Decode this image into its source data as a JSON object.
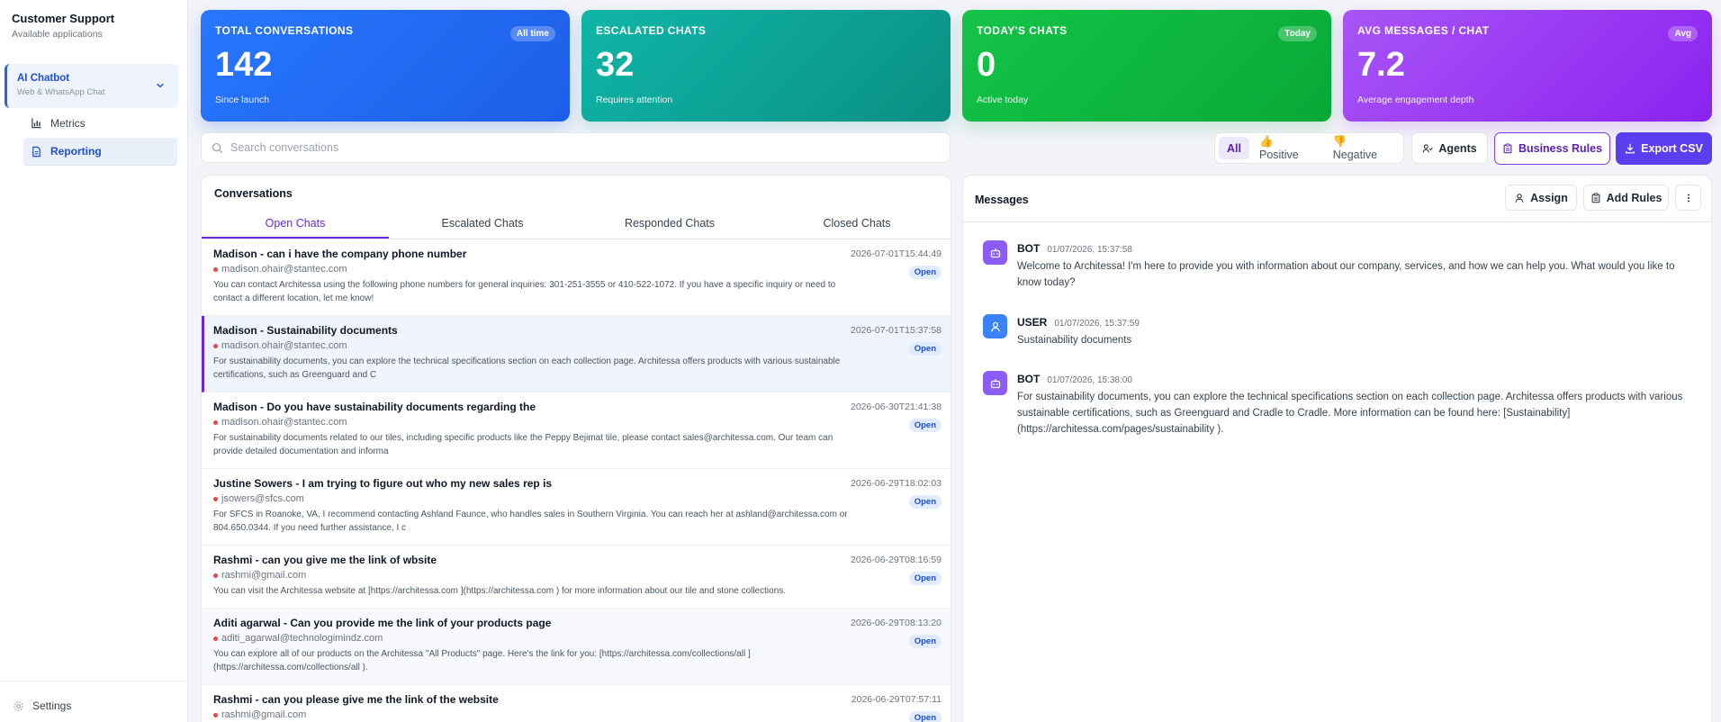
{
  "sidebar": {
    "brand_title": "Customer Support",
    "brand_sub": "Available applications",
    "app_name": "AI Chatbot",
    "app_sub": "Web & WhatsApp Chat",
    "nav_metrics": "Metrics",
    "nav_reporting": "Reporting",
    "settings": "Settings"
  },
  "stats": [
    {
      "label": "Total Conversations",
      "value": "142",
      "sub": "Since launch",
      "badge": "All time"
    },
    {
      "label": "Escalated Chats",
      "value": "32",
      "sub": "Requires attention",
      "badge": ""
    },
    {
      "label": "Today's Chats",
      "value": "0",
      "sub": "Active today",
      "badge": "Today"
    },
    {
      "label": "Avg Messages / Chat",
      "value": "7.2",
      "sub": "Average engagement depth",
      "badge": "Avg"
    }
  ],
  "toolbar": {
    "search_placeholder": "Search conversations",
    "filter_all": "All",
    "filter_positive": "👍 Positive",
    "filter_negative": "👎 Negative",
    "agents": "Agents",
    "business_rules": "Business Rules",
    "export_csv": "Export CSV"
  },
  "conversations": {
    "title": "Conversations",
    "tabs": [
      "Open Chats",
      "Escalated Chats",
      "Responded Chats",
      "Closed Chats"
    ],
    "rows": [
      {
        "title": "Madison - can i have the company phone number",
        "email": "madison.ohair@stantec.com",
        "time": "2026-07-01T15:44:49",
        "status": "Open",
        "preview": "You can contact Architessa using the following phone numbers for general inquiries: 301-251-3555 or 410-522-1072. If you have a specific inquiry or need to contact a different location, let me know!"
      },
      {
        "title": "Madison - Sustainability documents",
        "email": "madison.ohair@stantec.com",
        "time": "2026-07-01T15:37:58",
        "status": "Open",
        "preview": "For sustainability documents, you can explore the technical specifications section on each collection page. Architessa offers products with various sustainable certifications, such as Greenguard and C"
      },
      {
        "title": "Madison - Do you have sustainability documents regarding the",
        "email": "madison.ohair@stantec.com",
        "time": "2026-06-30T21:41:38",
        "status": "Open",
        "preview": "For sustainability documents related to our tiles, including specific products like the Peppy Bejimat tile, please contact sales@architessa.com. Our team can provide detailed documentation and informa"
      },
      {
        "title": "Justine Sowers - I am trying to figure out who my new sales rep is",
        "email": "jsowers@sfcs.com",
        "time": "2026-06-29T18:02:03",
        "status": "Open",
        "preview": "For SFCS in Roanoke, VA, I recommend contacting Ashland Faunce, who handles sales in Southern Virginia. You can reach her at ashland@architessa.com or 804.650.0344. If you need further assistance, I c"
      },
      {
        "title": "Rashmi - can you give me the link of wbsite",
        "email": "rashmi@gmail.com",
        "time": "2026-06-29T08:16:59",
        "status": "Open",
        "preview": "You can visit the Architessa website at [https://architessa.com ](https://architessa.com ) for more information about our tile and stone collections."
      },
      {
        "title": "Aditi agarwal - Can you provide me the link of your products page",
        "email": "aditi_agarwal@technologimindz.com",
        "time": "2026-06-29T08:13:20",
        "status": "Open",
        "preview": "You can explore all of our products on the Architessa \"All Products\" page. Here's the link for you: [https://architessa.com/collections/all ](https://architessa.com/collections/all )."
      },
      {
        "title": "Rashmi - can you please give me the link of the website",
        "email": "rashmi@gmail.com",
        "time": "2026-06-29T07:57:11",
        "status": "Open",
        "preview": ""
      }
    ]
  },
  "messages": {
    "title": "Messages",
    "assign": "Assign",
    "add_rules": "Add Rules",
    "items": [
      {
        "sender": "BOT",
        "time": "01/07/2026, 15:37:58",
        "text": "Welcome to Architessa! I'm here to provide you with information about our company, services, and how we can help you. What would you like to know today?"
      },
      {
        "sender": "USER",
        "time": "01/07/2026, 15:37:59",
        "text": "Sustainability documents"
      },
      {
        "sender": "BOT",
        "time": "01/07/2026, 15:38:00",
        "text": "For sustainability documents, you can explore the technical specifications section on each collection page. Architessa offers products with various sustainable certifications, such as Greenguard and Cradle to Cradle. More information can be found here: [Sustainability](https://architessa.com/pages/sustainability )."
      }
    ]
  },
  "colors": {
    "accent": "#6d28d9",
    "primary_blue": "#2563eb",
    "export": "#5b3ef0"
  }
}
